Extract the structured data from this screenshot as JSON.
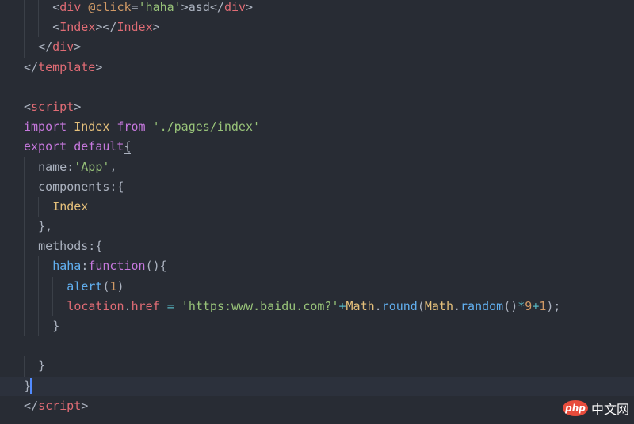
{
  "editor": {
    "theme_colors": {
      "background": "#282c34",
      "tag": "#e06c75",
      "attribute": "#d19a66",
      "string": "#98c379",
      "keyword": "#c678dd",
      "class": "#e5c07b",
      "function": "#61afef",
      "plain": "#abb2bf"
    },
    "lines": [
      [
        [
          "punct",
          "<"
        ],
        [
          "tag",
          "div"
        ],
        [
          "plain",
          " "
        ],
        [
          "attr",
          "@click"
        ],
        [
          "punct",
          "="
        ],
        [
          "str",
          "'haha'"
        ],
        [
          "punct",
          ">"
        ],
        [
          "plain",
          "asd"
        ],
        [
          "punct",
          "</"
        ],
        [
          "tag",
          "div"
        ],
        [
          "punct",
          ">"
        ]
      ],
      [
        [
          "punct",
          "<"
        ],
        [
          "tag",
          "Index"
        ],
        [
          "punct",
          "></"
        ],
        [
          "tag",
          "Index"
        ],
        [
          "punct",
          ">"
        ]
      ],
      [
        [
          "punct",
          "</"
        ],
        [
          "tag",
          "div"
        ],
        [
          "punct",
          ">"
        ]
      ],
      [
        [
          "punct",
          "</"
        ],
        [
          "tag",
          "template"
        ],
        [
          "punct",
          ">"
        ]
      ],
      [],
      [
        [
          "punct",
          "<"
        ],
        [
          "tag",
          "script"
        ],
        [
          "punct",
          ">"
        ]
      ],
      [
        [
          "kw",
          "import"
        ],
        [
          "plain",
          " "
        ],
        [
          "cls",
          "Index"
        ],
        [
          "plain",
          " "
        ],
        [
          "kw",
          "from"
        ],
        [
          "plain",
          " "
        ],
        [
          "str",
          "'./pages/index'"
        ]
      ],
      [
        [
          "kw",
          "export"
        ],
        [
          "plain",
          " "
        ],
        [
          "kw",
          "default"
        ],
        [
          "punct",
          "{"
        ]
      ],
      [
        [
          "plain",
          "name:"
        ],
        [
          "str",
          "'App'"
        ],
        [
          "punct",
          ","
        ]
      ],
      [
        [
          "plain",
          "components:"
        ],
        [
          "punct",
          "{"
        ]
      ],
      [
        [
          "cls",
          "Index"
        ]
      ],
      [
        [
          "punct",
          "},"
        ]
      ],
      [
        [
          "plain",
          "methods:"
        ],
        [
          "punct",
          "{"
        ]
      ],
      [
        [
          "fn",
          "haha"
        ],
        [
          "plain",
          ":"
        ],
        [
          "kw",
          "function"
        ],
        [
          "punct",
          "(){"
        ]
      ],
      [
        [
          "fn",
          "alert"
        ],
        [
          "punct",
          "("
        ],
        [
          "num",
          "1"
        ],
        [
          "punct",
          ")"
        ]
      ],
      [
        [
          "prop",
          "location"
        ],
        [
          "punct",
          "."
        ],
        [
          "prop",
          "href"
        ],
        [
          "plain",
          " "
        ],
        [
          "op",
          "="
        ],
        [
          "plain",
          " "
        ],
        [
          "str",
          "'https:www.baidu.com?'"
        ],
        [
          "op",
          "+"
        ],
        [
          "cls",
          "Math"
        ],
        [
          "punct",
          "."
        ],
        [
          "fn",
          "round"
        ],
        [
          "punct",
          "("
        ],
        [
          "cls",
          "Math"
        ],
        [
          "punct",
          "."
        ],
        [
          "fn",
          "random"
        ],
        [
          "punct",
          "()"
        ],
        [
          "op",
          "*"
        ],
        [
          "num",
          "9"
        ],
        [
          "op",
          "+"
        ],
        [
          "num",
          "1"
        ],
        [
          "punct",
          ");"
        ]
      ],
      [
        [
          "punct",
          "}"
        ]
      ],
      [],
      [
        [
          "punct",
          "}"
        ]
      ],
      [
        [
          "punct",
          "}"
        ]
      ],
      [
        [
          "punct",
          "</"
        ],
        [
          "tag",
          "script"
        ],
        [
          "punct",
          ">"
        ]
      ]
    ],
    "indents": [
      2,
      2,
      1,
      0,
      0,
      0,
      0,
      0,
      1,
      1,
      2,
      1,
      1,
      2,
      3,
      3,
      2,
      0,
      1,
      0,
      0
    ],
    "active_line": 19
  },
  "watermark": {
    "logo_text": "php",
    "site_text": "中文网"
  }
}
